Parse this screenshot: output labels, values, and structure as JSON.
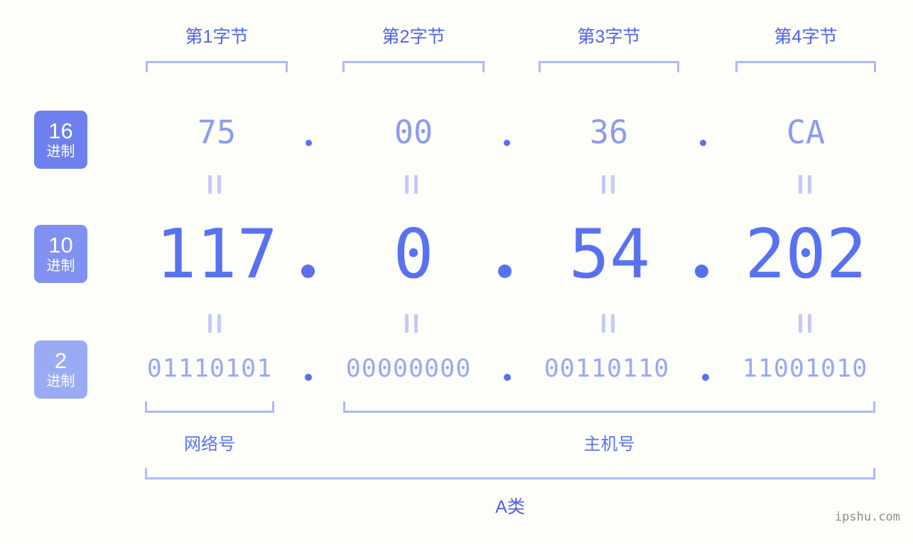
{
  "background_color": "#fdfdfa",
  "accent_colors": {
    "header_blue": "#4f63e8",
    "value_blue": "#5872ef",
    "hex_blue": "#8b9bf0",
    "binary_blue": "#9aa8f3",
    "bracket_blue": "#aeb8fb",
    "badge_dark": "#6d80ee",
    "badge_mid": "#7f91f1",
    "badge_light": "#9aabf5"
  },
  "byte_headers": [
    {
      "label": "第1字节"
    },
    {
      "label": "第2字节"
    },
    {
      "label": "第3字节"
    },
    {
      "label": "第4字节"
    }
  ],
  "rows": [
    {
      "key": "hex",
      "badge_number": "16",
      "badge_unit": "进制",
      "badge_color": "#6d80ee",
      "octets": [
        "75",
        "00",
        "36",
        "CA"
      ],
      "separator": "."
    },
    {
      "key": "dec",
      "badge_number": "10",
      "badge_unit": "进制",
      "badge_color": "#7f91f1",
      "octets": [
        "117",
        "0",
        "54",
        "202"
      ],
      "separator": "."
    },
    {
      "key": "bin",
      "badge_number": "2",
      "badge_unit": "进制",
      "badge_color": "#9aabf5",
      "octets": [
        "01110101",
        "00000000",
        "00110110",
        "11001010"
      ],
      "separator": "."
    }
  ],
  "equality_marks": {
    "glyph": "=",
    "count_per_row": 4,
    "rows": 2
  },
  "partition": {
    "network_label": "网络号",
    "host_label": "主机号"
  },
  "address_class": {
    "label": "A类"
  },
  "watermark": {
    "text": "ipshu.com"
  }
}
